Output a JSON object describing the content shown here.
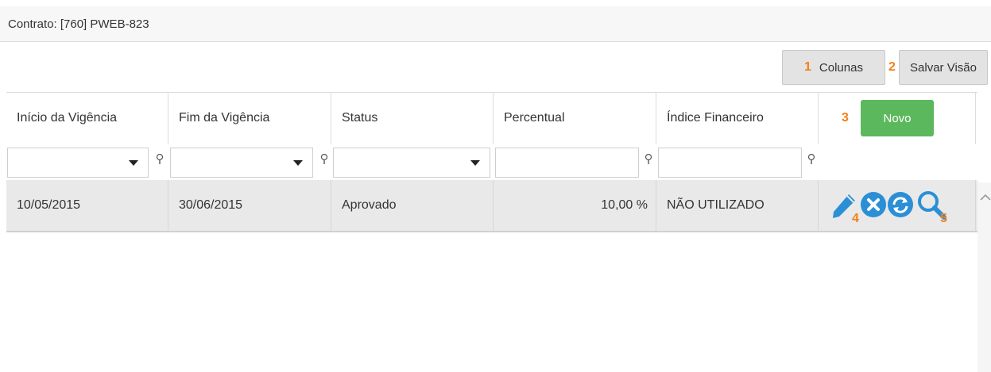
{
  "header": {
    "contract_label": "Contrato: [760] PWEB-823"
  },
  "toolbar": {
    "columns_num": "1",
    "columns_label": "Colunas",
    "save_num": "2",
    "save_label": "Salvar Visão"
  },
  "grid": {
    "columns": [
      "Início da Vigência",
      "Fim da Vigência",
      "Status",
      "Percentual",
      "Índice Financeiro"
    ],
    "new_num": "3",
    "new_label": "Novo",
    "rows": [
      {
        "inicio": "10/05/2015",
        "fim": "30/06/2015",
        "status": "Aprovado",
        "percentual": "10,00 %",
        "indice": "NÃO UTILIZADO"
      }
    ],
    "action_nums": {
      "edit": "4",
      "search": "5"
    }
  },
  "colors": {
    "accent_blue": "#2b8fd6",
    "novo_green": "#5cb85c",
    "marker_orange": "#f57f17"
  },
  "icons": [
    "pencil-icon",
    "cancel-icon",
    "refresh-icon",
    "search-icon",
    "filter-pin-icon",
    "chevron-up-icon"
  ]
}
